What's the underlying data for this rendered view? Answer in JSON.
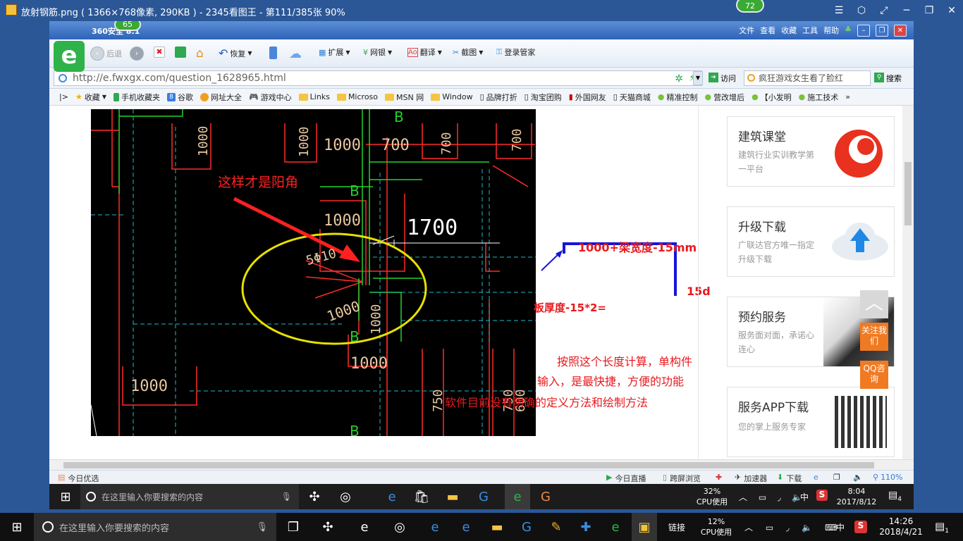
{
  "outer_window": {
    "title": "放射钢筋.png ( 1366×768像素, 290KB ) - 2345看图王 - 第111/385张 90%",
    "badge": "72"
  },
  "browser": {
    "version_label": "360安全    8.1",
    "badge": "65",
    "menu": [
      "文件",
      "查看",
      "收藏",
      "工具",
      "帮助"
    ],
    "toolbar": {
      "back": "后退",
      "restore": "恢复",
      "expand": "扩展",
      "bank": "网银",
      "translate": "翻译",
      "screenshot": "截图",
      "login": "登录管家"
    },
    "address": "http://e.fwxgx.com/question_1628965.html",
    "visit": "访问",
    "search_text": "疯狂游戏女生看了脸红",
    "search_btn": "搜索",
    "favorites": [
      "收藏",
      "手机收藏夹",
      "谷歌",
      "网址大全",
      "游戏中心",
      "Links",
      "Microso",
      "MSN 网",
      "Window",
      "品牌打折",
      "淘宝团购",
      "外国网友",
      "天猫商城",
      "精准控制",
      "营改增后",
      "【小发明",
      "施工技术"
    ],
    "status_left": "今日优选",
    "status_right": [
      "今日直播",
      "跨屏浏览",
      "加速器",
      "下载",
      "110%"
    ]
  },
  "cad": {
    "annotation": "这样才是阳角",
    "labels": [
      "1000",
      "1000",
      "700",
      "700",
      "1000",
      "1700",
      "5Φ10",
      "1000",
      "1000",
      "1000",
      "1000",
      "750",
      "750",
      "600"
    ],
    "b_marks": [
      "B",
      "B",
      "B",
      "B"
    ]
  },
  "notes": {
    "formula1": "1000+梁宽度-15mm",
    "formula2": "15d",
    "formula3": "板厚度-15*2=",
    "line1": "按照这个长度计算，单构件",
    "line2": "输入，是最快捷，方便的功能",
    "line3": "软件目前没有明确的定义方法和绘制方法"
  },
  "sidebar": [
    {
      "title": "建筑课堂",
      "sub": "建筑行业实训教学第一平台"
    },
    {
      "title": "升级下载",
      "sub": "广联达官方唯一指定升级下载"
    },
    {
      "title": "预约服务",
      "sub": "服务面对面，承诺心连心"
    },
    {
      "title": "服务APP下载",
      "sub": "您的掌上服务专家"
    }
  ],
  "float_buttons": {
    "follow": "关注我们",
    "qq": "QQ咨询"
  },
  "inner_taskbar": {
    "search": "在这里输入你要搜索的内容",
    "cpu_pct": "32%",
    "cpu_label": "CPU使用",
    "ime": "中",
    "time": "8:04",
    "date": "2017/8/12",
    "notif": "4"
  },
  "os_taskbar": {
    "search": "在这里输入你要搜索的内容",
    "link": "链接",
    "cpu_pct": "12%",
    "cpu_label": "CPU使用",
    "ime": "中",
    "time": "14:26",
    "date": "2018/4/21",
    "notif": "1"
  },
  "colors": {
    "title_blue": "#2b5797",
    "accent_red": "#e8191e",
    "line_blue": "#1515d8",
    "annotation_red": "#ff2020",
    "ellipse_yellow": "#e8e000"
  }
}
